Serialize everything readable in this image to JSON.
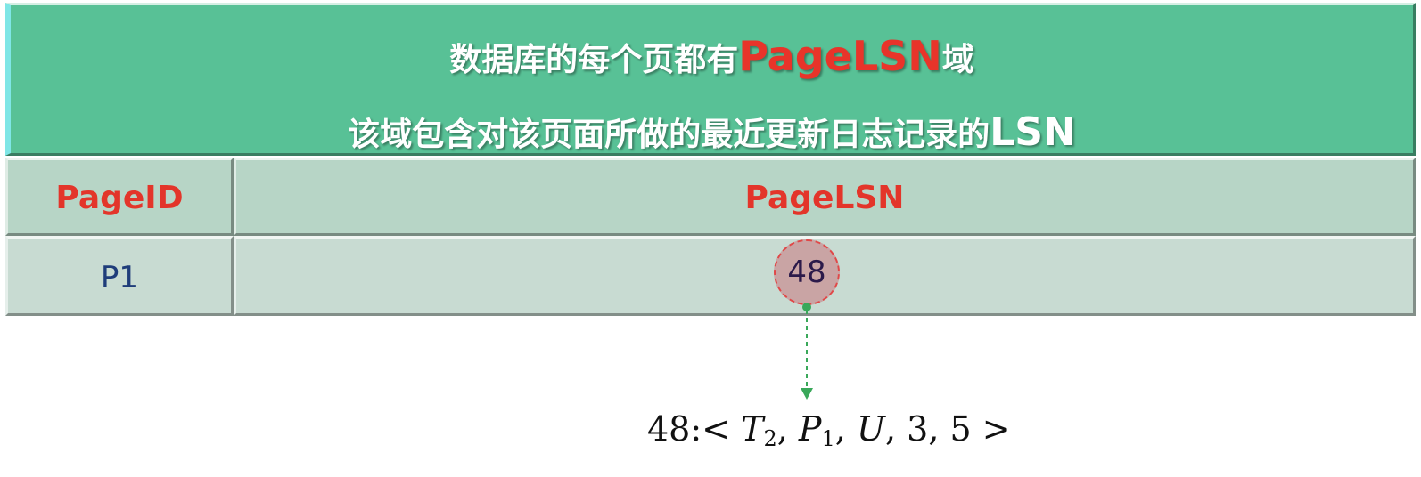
{
  "title": {
    "line1_prefix": "数据库的每个页都有",
    "line1_highlight": "PageLSN",
    "line1_suffix": "域",
    "line2_prefix": "该域包含对该页面所做的最近更新日志记录的",
    "line2_highlight": "LSN"
  },
  "table": {
    "headers": [
      "PageID",
      "PageLSN"
    ],
    "rows": [
      [
        "P1",
        "48"
      ]
    ]
  },
  "log_record": {
    "lsn": "48",
    "open": "< ",
    "t": "T",
    "t_sub": "2",
    "p": "P",
    "p_sub": "1",
    "u": "U",
    "v1": "3",
    "v2": "5",
    "close": " >"
  },
  "colors": {
    "title_bg": "#58c196",
    "header_bg": "#b7d5c6",
    "row_bg": "#c8dbd2",
    "accent_red": "#e3352a",
    "arrow_green": "#3aa85a"
  }
}
